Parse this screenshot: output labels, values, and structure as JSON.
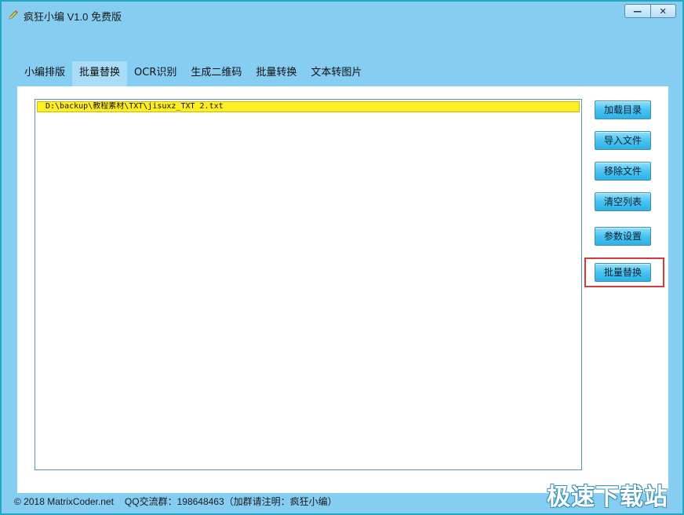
{
  "window": {
    "title": "疯狂小编 V1.0 免费版",
    "controls": {
      "minimize": "—",
      "close": "✕"
    }
  },
  "tabs": [
    {
      "label": "小编排版"
    },
    {
      "label": "批量替换"
    },
    {
      "label": "OCR识别"
    },
    {
      "label": "生成二维码"
    },
    {
      "label": "批量转换"
    },
    {
      "label": "文本转图片"
    }
  ],
  "active_tab": "批量替换",
  "file_list": {
    "items": [
      "D:\\backup\\教程素材\\TXT\\jisuxz_TXT 2.txt"
    ]
  },
  "buttons": {
    "load_dir": "加载目录",
    "import_file": "导入文件",
    "remove_file": "移除文件",
    "clear_list": "清空列表",
    "settings": "参数设置",
    "batch_replace": "批量替换"
  },
  "footer": {
    "copyright": "© 2018 MatrixCoder.net",
    "qq_group": "QQ交流群：198648463（加群请注明：疯狂小编）"
  },
  "watermark": "极速下载站",
  "colors": {
    "window_bg": "#86cdf2",
    "content_bg": "#ffffff",
    "selected_row": "#ffee22",
    "button_accent": "#49c3f0",
    "highlight": "#d43a3a"
  }
}
